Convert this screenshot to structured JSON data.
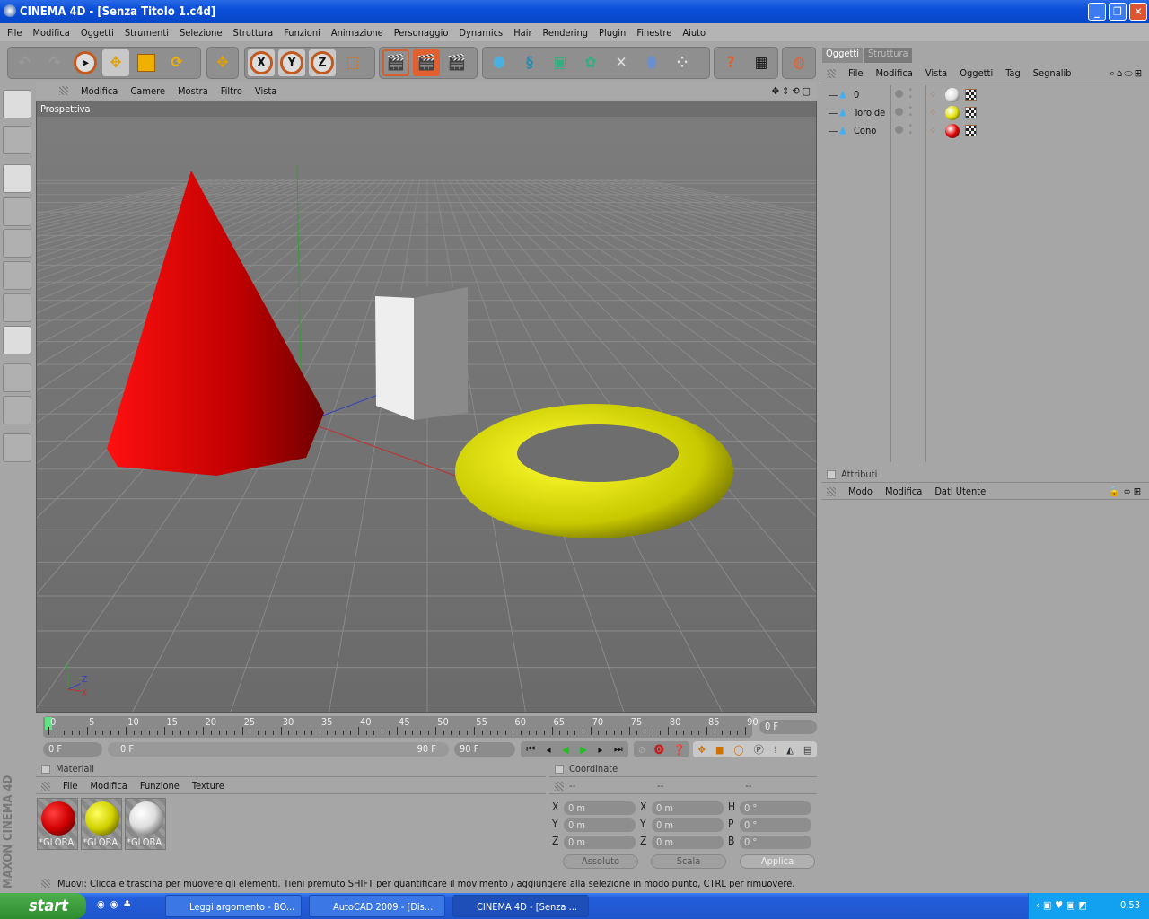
{
  "window": {
    "title": "CINEMA 4D - [Senza Titolo 1.c4d]",
    "controls": [
      "_",
      "❐",
      "✕"
    ]
  },
  "menubar": [
    "File",
    "Modifica",
    "Oggetti",
    "Strumenti",
    "Selezione",
    "Struttura",
    "Funzioni",
    "Animazione",
    "Personaggio",
    "Dynamics",
    "Hair",
    "Rendering",
    "Plugin",
    "Finestre",
    "Aiuto"
  ],
  "toolbar": {
    "axis_x": "X",
    "axis_y": "Y",
    "axis_z": "Z",
    "icons": [
      "undo",
      "redo",
      "live-selection",
      "move",
      "scale",
      "rotate",
      "move-tool",
      "x-axis",
      "y-axis",
      "z-axis",
      "coordinate-system",
      "render-view",
      "render-picture-viewer",
      "render-settings",
      "cube",
      "spline-pen",
      "nurbs",
      "array",
      "deformer",
      "scene",
      "particles",
      "help-pointer",
      "table",
      "internet"
    ]
  },
  "viewport": {
    "menu": [
      "Modifica",
      "Camere",
      "Mostra",
      "Filtro",
      "Vista"
    ],
    "title": "Prospettiva",
    "mini_axes": {
      "y": "Y",
      "z": "Z",
      "x": "X"
    },
    "objects": {
      "cone_color": "#e00000",
      "torus_color": "#e8e800",
      "box_color": "#e8e8e8"
    }
  },
  "timeline": {
    "ticks": [
      "0",
      "5",
      "10",
      "15",
      "20",
      "25",
      "30",
      "35",
      "40",
      "45",
      "50",
      "55",
      "60",
      "65",
      "70",
      "75",
      "80",
      "85",
      "90"
    ],
    "current": "0 F",
    "start": "0 F",
    "range_start": "0 F",
    "range_end": "90 F",
    "end": "90 F"
  },
  "objects_panel": {
    "tabs": [
      "Oggetti",
      "Struttura"
    ],
    "menu": [
      "File",
      "Modifica",
      "Vista",
      "Oggetti",
      "Tag",
      "Segnalib"
    ],
    "items": [
      {
        "name": "0",
        "material": "#e0e0e0"
      },
      {
        "name": "Toroide",
        "material": "#e0e000"
      },
      {
        "name": "Cono",
        "material": "#e00000"
      }
    ]
  },
  "attributes_panel": {
    "title": "Attributi",
    "menu": [
      "Modo",
      "Modifica",
      "Dati Utente"
    ]
  },
  "materials_panel": {
    "title": "Materiali",
    "menu": [
      "File",
      "Modifica",
      "Funzione",
      "Texture"
    ],
    "materials": [
      {
        "label": "*GLOBA",
        "color": "#e00000"
      },
      {
        "label": "*GLOBA",
        "color": "#e0e000"
      },
      {
        "label": "*GLOBA",
        "color": "#f0f0f0"
      }
    ]
  },
  "coordinates_panel": {
    "title": "Coordinate",
    "headers": [
      "--",
      "--",
      "--"
    ],
    "rows": [
      {
        "a": "X",
        "av": "0 m",
        "b": "X",
        "bv": "0 m",
        "c": "H",
        "cv": "0 °"
      },
      {
        "a": "Y",
        "av": "0 m",
        "b": "Y",
        "bv": "0 m",
        "c": "P",
        "cv": "0 °"
      },
      {
        "a": "Z",
        "av": "0 m",
        "b": "Z",
        "bv": "0 m",
        "c": "B",
        "cv": "0 °"
      }
    ],
    "mode": "Assoluto",
    "type": "Scala",
    "apply": "Applica"
  },
  "status": "Muovi: Clicca e trascina per muovere gli elementi. Tieni premuto SHIFT per quantificare il movimento / aggiungere alla selezione in modo punto, CTRL per rimuovere.",
  "brand": "MAXON CINEMA 4D",
  "taskbar": {
    "start": "start",
    "tasks": [
      "Leggi argomento - BO...",
      "AutoCAD 2009 - [Dis...",
      "CINEMA 4D - [Senza ..."
    ],
    "clock": "0.53"
  }
}
